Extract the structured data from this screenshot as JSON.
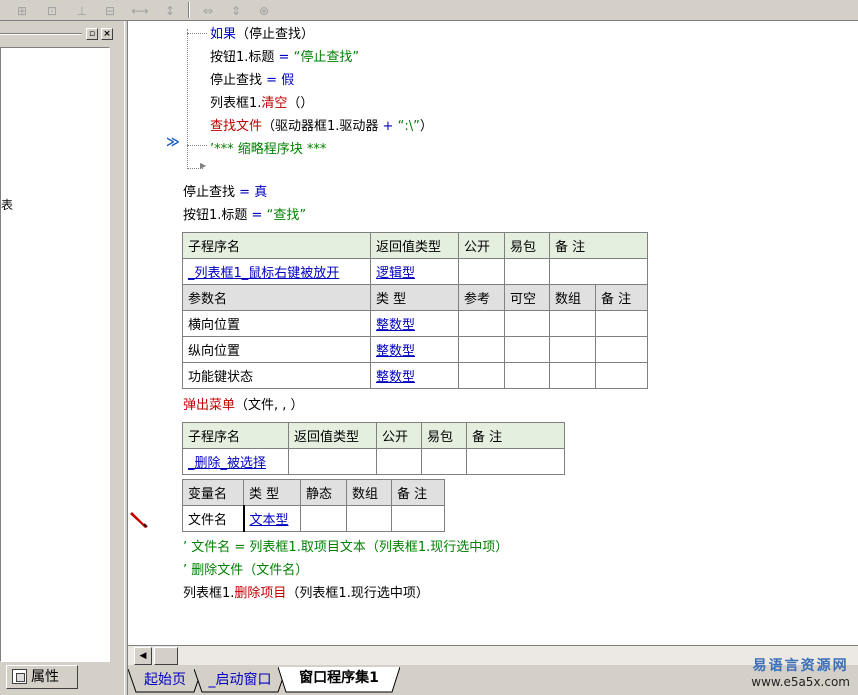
{
  "toolbar": {
    "buttons": [
      "align-left-icon",
      "align-center-icon",
      "align-top-icon",
      "align-middle-icon",
      "space-horizontal-icon",
      "space-vertical-icon",
      "same-width-icon",
      "same-height-icon",
      "same-size-icon"
    ]
  },
  "left_panel": {
    "edge_text": "表",
    "tab_label": "属性"
  },
  "code": {
    "line1_kw": "如果",
    "line1_rest": "（停止查找）",
    "line2_a": "按钮1.标题",
    "line2_op": " = ",
    "line2_str": "“停止查找”",
    "line3_a": "停止查找",
    "line3_op": " = ",
    "line3_val": "假",
    "line4_a": "列表框1.",
    "line4_fn": "清空",
    "line4_b": "（）",
    "line5_fn": "查找文件",
    "line5_a": "（驱动器框1.驱动器",
    "line5_op": " + ",
    "line5_str": "“:\\”",
    "line5_b": "）",
    "line6_cm": "’*** 缩略程序块 ***",
    "line7_a": "停止查找",
    "line7_op": " = ",
    "line7_val": "真",
    "line8_a": "按钮1.标题",
    "line8_op": " = ",
    "line8_str": "“查找”"
  },
  "sub1": {
    "headers": [
      "子程序名",
      "返回值类型",
      "公开",
      "易包",
      "备 注"
    ],
    "name": "_列表框1_鼠标右键被放开",
    "return_type": "逻辑型",
    "param_headers": [
      "参数名",
      "类 型",
      "参考",
      "可空",
      "数组",
      "备 注"
    ],
    "params": [
      {
        "name": "横向位置",
        "type": "整数型"
      },
      {
        "name": "纵向位置",
        "type": "整数型"
      },
      {
        "name": "功能键状态",
        "type": "整数型"
      }
    ],
    "body_fn": "弹出菜单",
    "body_rest": "（文件, , ）"
  },
  "sub2": {
    "headers": [
      "子程序名",
      "返回值类型",
      "公开",
      "易包",
      "备 注"
    ],
    "name": "_删除_被选择",
    "var_headers": [
      "变量名",
      "类 型",
      "静态",
      "数组",
      "备 注"
    ],
    "var_name": "文件名",
    "var_type": "文本型",
    "line1_cm": "’ 文件名 = 列表框1.取项目文本（列表框1.现行选中项）",
    "line2_cm": "’ 删除文件（文件名）",
    "line3_a": "列表框1.",
    "line3_fn": "删除项目",
    "line3_b": "（列表框1.现行选中项）"
  },
  "tabs": [
    {
      "label": "起始页",
      "active": false
    },
    {
      "label": "_启动窗口",
      "active": false
    },
    {
      "label": "窗口程序集1",
      "active": true
    }
  ],
  "watermark": {
    "line1": "易语言资源网",
    "line2": "www.e5a5x.com"
  }
}
